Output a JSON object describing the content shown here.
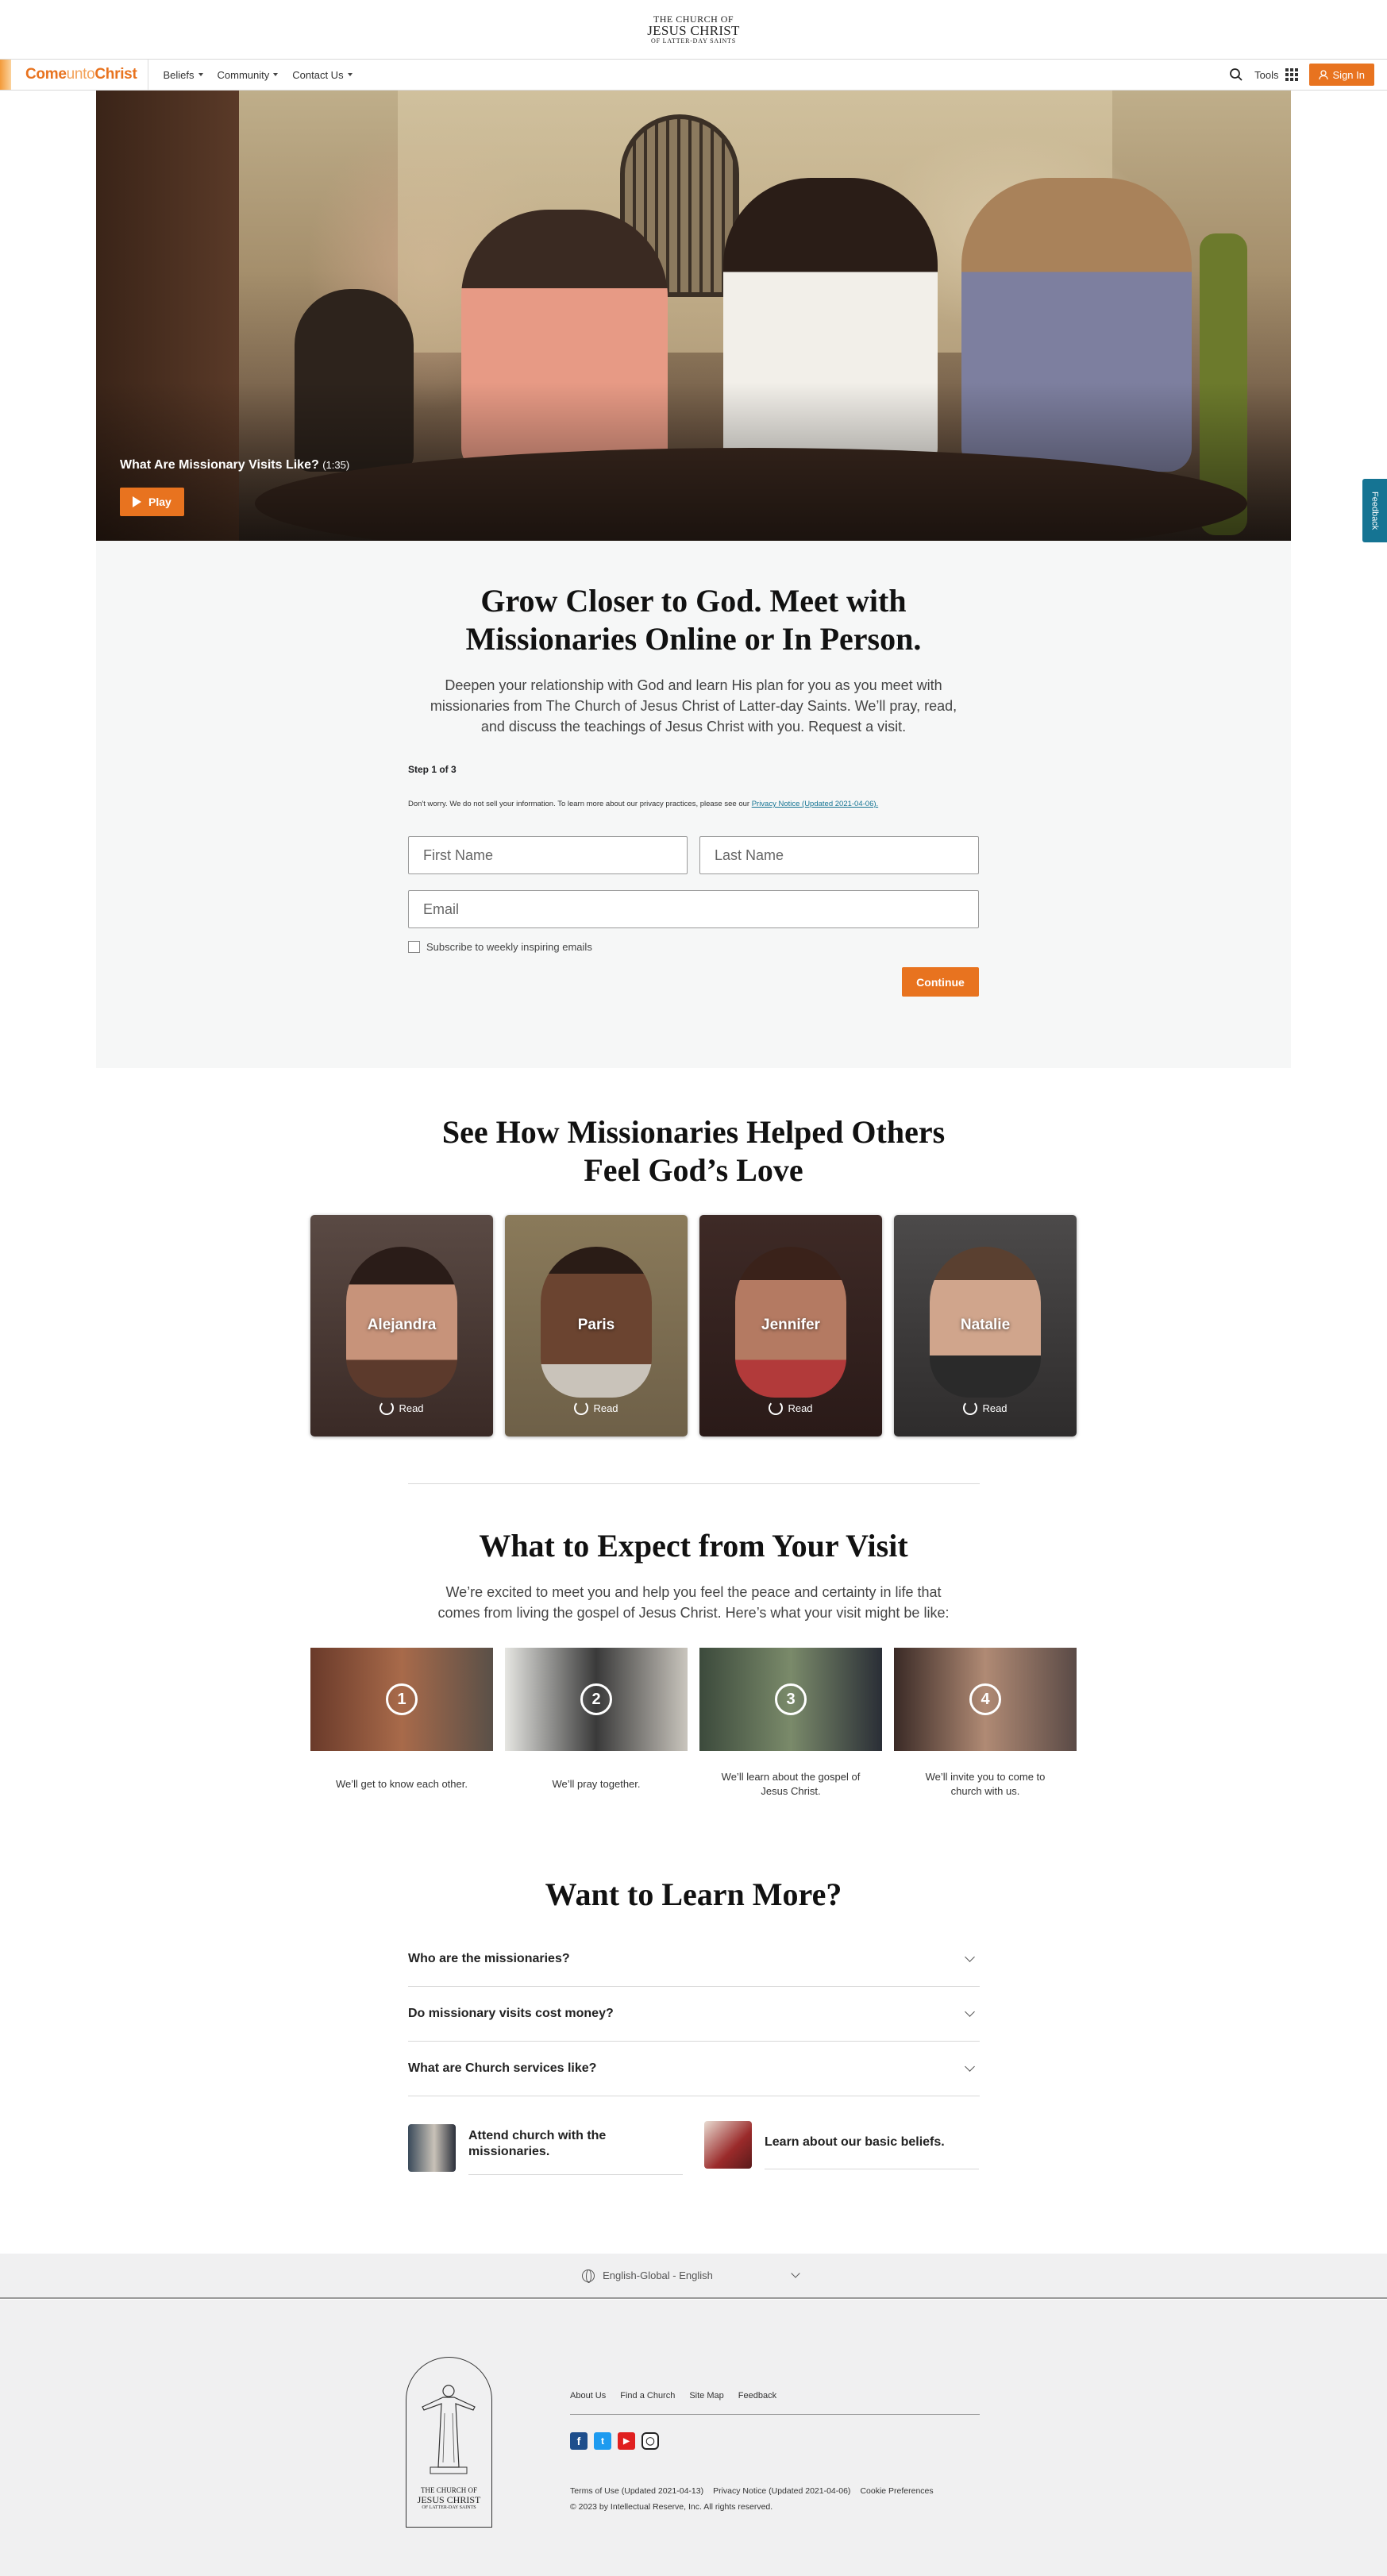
{
  "logo": {
    "line1": "THE CHURCH OF",
    "line2": "JESUS CHRIST",
    "line3": "OF LATTER-DAY SAINTS"
  },
  "nav": {
    "brand": {
      "part1": "Come",
      "part2": "unto",
      "part3": "Christ"
    },
    "items": [
      "Beliefs",
      "Community",
      "Contact Us"
    ],
    "tools_label": "Tools",
    "signin_label": "Sign In",
    "icons": [
      "search-icon",
      "apps-grid-icon",
      "person-icon"
    ]
  },
  "hero": {
    "caption": "What Are Missionary Visits Like?",
    "duration": "(1:35)",
    "play_label": "Play"
  },
  "feedback_label": "Feedback",
  "form_section": {
    "title_line1": "Grow Closer to God. Meet with",
    "title_line2": "Missionaries Online or In Person.",
    "lead_line1": "Deepen your relationship with God and learn His plan for you as you meet with",
    "lead_line2": "missionaries from The Church of Jesus Christ of Latter-day Saints. We’ll pray, read,",
    "lead_line3": "and discuss the teachings of Jesus Christ with you. Request a visit.",
    "step": "Step 1 of 3",
    "privacy_text": "Don't worry. We do not sell your information. To learn more about our privacy practices, please see our",
    "privacy_link": "Privacy Notice (Updated 2021-04-06).",
    "first_name_placeholder": "First Name",
    "last_name_placeholder": "Last Name",
    "email_placeholder": "Email",
    "subscribe_label": "Subscribe to weekly inspiring emails",
    "subscribe_checked": false,
    "continue_label": "Continue"
  },
  "stories": {
    "title_line1": "See How Missionaries Helped Others",
    "title_line2": "Feel God’s Love",
    "cards": [
      {
        "name": "Alejandra",
        "action": "Read"
      },
      {
        "name": "Paris",
        "action": "Read"
      },
      {
        "name": "Jennifer",
        "action": "Read"
      },
      {
        "name": "Natalie",
        "action": "Read"
      }
    ]
  },
  "expect": {
    "title": "What to Expect from Your Visit",
    "lead_line1": "We’re excited to meet you and help you feel the peace and certainty in life that",
    "lead_line2": "comes from living the gospel of Jesus Christ. Here’s what your visit might be like:",
    "steps": [
      {
        "number": "1",
        "caption_line1": "We’ll get to know each other.",
        "caption_line2": ""
      },
      {
        "number": "2",
        "caption_line1": "We’ll pray together.",
        "caption_line2": ""
      },
      {
        "number": "3",
        "caption_line1": "We’ll learn about the gospel of",
        "caption_line2": "Jesus Christ."
      },
      {
        "number": "4",
        "caption_line1": "We’ll invite you to come to",
        "caption_line2": "church with us."
      }
    ]
  },
  "learn_more": {
    "title": "Want to Learn More?",
    "questions": [
      "Who are the missionaries?",
      "Do missionary visits cost money?",
      "What are Church services like?"
    ],
    "promos": [
      {
        "line1": "Attend church with the",
        "line2": "missionaries."
      },
      {
        "line1": "Learn about our basic beliefs.",
        "line2": ""
      }
    ]
  },
  "footer": {
    "language": "English-Global - English",
    "links": [
      "About Us",
      "Find a Church",
      "Site Map",
      "Feedback"
    ],
    "social_icons": [
      "facebook-icon",
      "twitter-icon",
      "youtube-icon",
      "instagram-icon"
    ],
    "legal_links": [
      "Terms of Use (Updated 2021-04-13)",
      "Privacy Notice (Updated 2021-04-06)",
      "Cookie Preferences"
    ],
    "copyright": "© 2023 by Intellectual Reserve, Inc. All rights reserved."
  },
  "colors": {
    "accent": "#e8731f",
    "link": "#157493",
    "section_bg": "#f6f7f7",
    "footer_bg": "#f0f0f1"
  }
}
